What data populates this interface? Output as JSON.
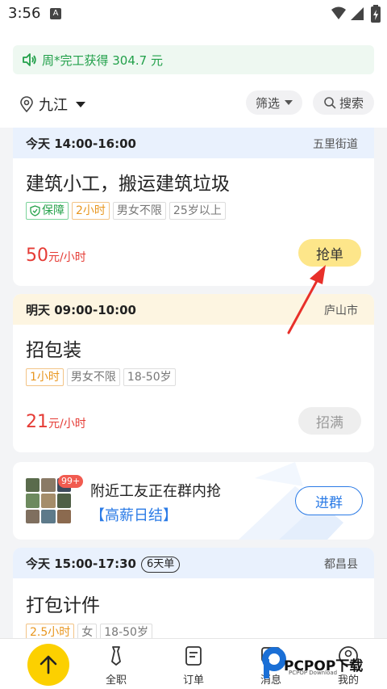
{
  "status_bar": {
    "time": "3:56",
    "app_badge": "A"
  },
  "notice": {
    "text": "周*完工获得 304.7 元",
    "icon": "speaker-icon"
  },
  "location": {
    "city": "九江",
    "icon": "location-pin-icon"
  },
  "filter": {
    "label": "筛选"
  },
  "search": {
    "label": "搜索",
    "icon": "search-icon"
  },
  "jobs": [
    {
      "time": "今天 14:00-16:00",
      "location": "五里街道",
      "title": "建筑小工，搬运建筑垃圾",
      "tags": [
        "保障",
        "2小时",
        "男女不限",
        "25岁以上"
      ],
      "price": "50",
      "price_unit": "元/小时",
      "action": "抢单"
    },
    {
      "time": "明天 09:00-10:00",
      "location": "庐山市",
      "title": "招包装",
      "tags": [
        "1小时",
        "男女不限",
        "18-50岁"
      ],
      "price": "21",
      "price_unit": "元/小时",
      "action": "招满"
    },
    {
      "time": "今天 15:00-17:30",
      "days_badge": "6天单",
      "location": "都昌县",
      "title": "打包计件",
      "tags": [
        "2.5小时",
        "女",
        "18-50岁"
      ]
    }
  ],
  "group": {
    "badge": "99+",
    "title": "附近工友正在群内抢",
    "subtitle": "【高薪日结】",
    "button": "进群"
  },
  "tabs": [
    {
      "label": "",
      "icon": "arrow-up-icon"
    },
    {
      "label": "全职",
      "icon": "tie-icon"
    },
    {
      "label": "订单",
      "icon": "document-icon"
    },
    {
      "label": "消息",
      "icon": "chat-icon"
    },
    {
      "label": "我的",
      "icon": "user-icon"
    }
  ],
  "watermark": {
    "text": "PCPOP下载",
    "sub": "PCPOP Download"
  },
  "colors": {
    "accent_yellow": "#fcd000",
    "price_red": "#e53b35",
    "link_blue": "#2b7be6",
    "notice_green": "#22a04a"
  }
}
